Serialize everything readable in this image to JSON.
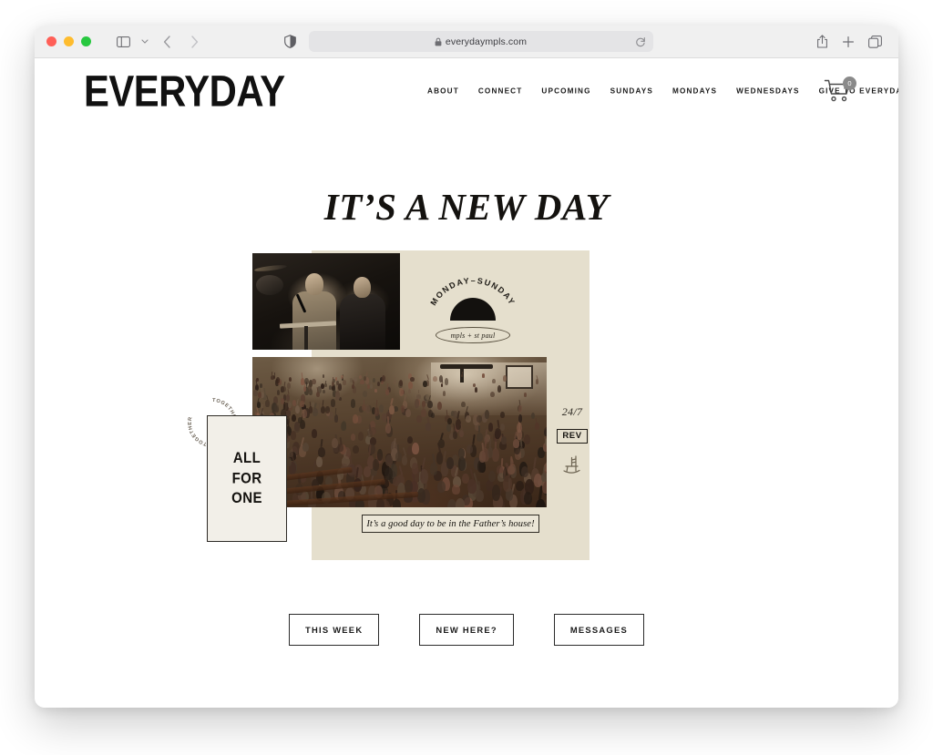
{
  "browser": {
    "traffic_lights": [
      "close",
      "minimize",
      "maximize"
    ],
    "sidebar_icon": "sidebar-icon",
    "tab_overview_chevron": "chevron-down-icon",
    "back_icon": "chevron-left-icon",
    "forward_icon": "chevron-right-icon",
    "shield_icon": "privacy-shield-icon",
    "lock_icon": "lock-icon",
    "url": "everydaympls.com",
    "reload_icon": "reload-icon",
    "share_icon": "share-icon",
    "new_tab_icon": "plus-icon",
    "tabs_icon": "tabs-overview-icon"
  },
  "site": {
    "logo": "EVERYDAY",
    "nav": [
      {
        "label": "ABOUT"
      },
      {
        "label": "CONNECT"
      },
      {
        "label": "UPCOMING"
      },
      {
        "label": "SUNDAYS"
      },
      {
        "label": "MONDAYS"
      },
      {
        "label": "WEDNESDAYS"
      },
      {
        "label": "GIVE TO EVERYDAY"
      }
    ],
    "cart": {
      "icon": "shopping-cart-icon",
      "count": "0"
    }
  },
  "hero": {
    "title": "IT’S A NEW DAY"
  },
  "collage": {
    "beige_color": "#e5dfcd",
    "stage_photo_alt": "two speakers on a dark stage, one holding a microphone",
    "crowd_photo_alt": "large crowd with raised hands in a warmly lit venue",
    "badge_arc_text": "MONDAY–SUNDAY",
    "badge_pill_text": "mpls + st paul",
    "card_line1": "ALL",
    "card_line2": "FOR",
    "card_line3": "ONE",
    "together_text": "TOGETHER TOGETHER TOGETHER ",
    "sticker_247": "24/7",
    "sticker_rev": "REV",
    "sticker_chair": "rocking-chair-icon",
    "caption": "It’s a good day to be in the Father’s house!"
  },
  "cta": [
    {
      "label": "THIS WEEK"
    },
    {
      "label": "NEW HERE?"
    },
    {
      "label": "MESSAGES"
    }
  ]
}
